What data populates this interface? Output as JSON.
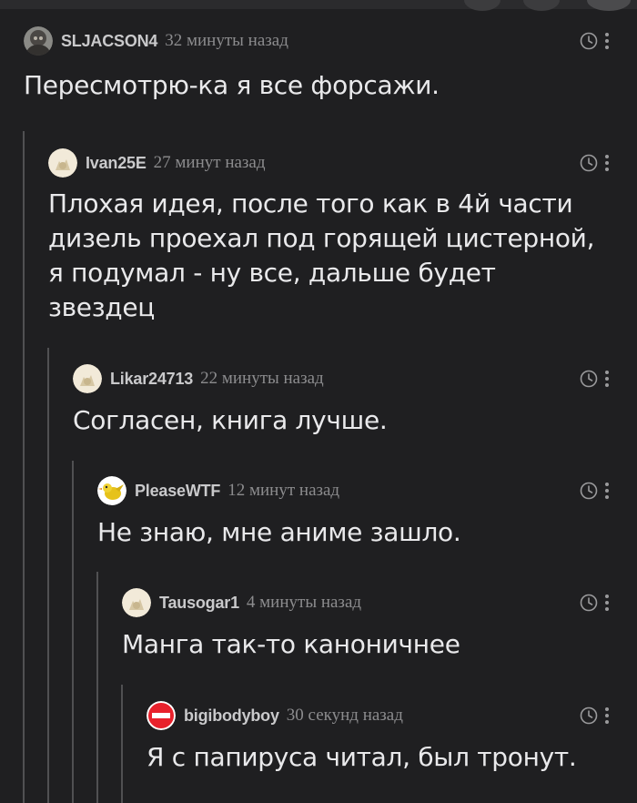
{
  "comments": [
    {
      "username": "SLJACSON4",
      "time": "32 минуты назад",
      "text": "Пересмотрю-ка я все форсажи."
    },
    {
      "username": "Ivan25E",
      "time": "27 минут назад",
      "text": "Плохая идея, после того как в 4й части дизель проехал под горящей цистерной, я подумал - ну все, дальше будет звездец"
    },
    {
      "username": "Likar24713",
      "time": "22 минуты назад",
      "text": "Согласен, книга лучше."
    },
    {
      "username": "PleaseWTF",
      "time": "12 минут назад",
      "text": "Не знаю, мне аниме зашло."
    },
    {
      "username": "Tausogar1",
      "time": "4 минуты назад",
      "text": "Манга так-то каноничнее"
    },
    {
      "username": "bigibodyboy",
      "time": "30 секунд назад",
      "text": "Я с папируса читал, был тронут."
    }
  ],
  "colors": {
    "background": "#1f1f21",
    "username": "#c9c9cb",
    "time": "#8c8c8e",
    "text": "#e9e9eb",
    "thread_line": "#505052",
    "icon": "#9a9a9c",
    "ban_red": "#e8212c"
  },
  "icons": {
    "clock": "clock-icon",
    "more": "more-vertical-icon",
    "ban": "ban-icon"
  }
}
